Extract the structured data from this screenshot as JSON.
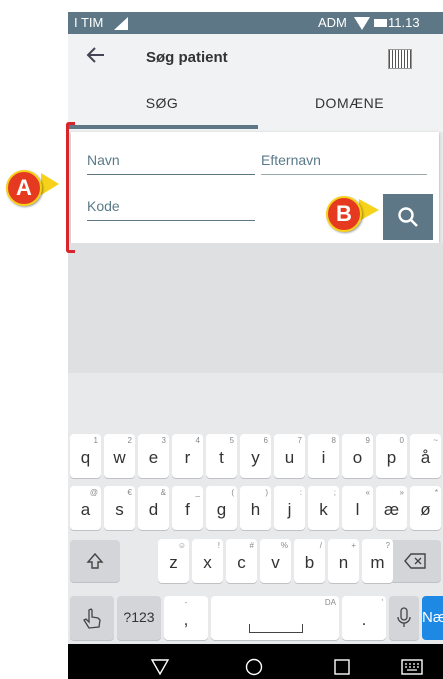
{
  "status_bar": {
    "carrier": "I TIM",
    "network": "ADM",
    "time": "11.13"
  },
  "app_bar": {
    "back_icon": "arrow-left-icon",
    "title": "Søg patient",
    "barcode_icon": "barcode-scanner-icon"
  },
  "tabs": [
    {
      "label": "SØG",
      "selected": true
    },
    {
      "label": "DOMÆNE",
      "selected": false
    }
  ],
  "form": {
    "navn_placeholder": "Navn",
    "efternavn_placeholder": "Efternavn",
    "kode_placeholder": "Kode",
    "search_icon": "search-icon"
  },
  "annotations": {
    "a": "A",
    "b": "B"
  },
  "keyboard": {
    "row1": [
      {
        "k": "q",
        "s": "1"
      },
      {
        "k": "w",
        "s": "2"
      },
      {
        "k": "e",
        "s": "3"
      },
      {
        "k": "r",
        "s": "4"
      },
      {
        "k": "t",
        "s": "5"
      },
      {
        "k": "y",
        "s": "6"
      },
      {
        "k": "u",
        "s": "7"
      },
      {
        "k": "i",
        "s": "8"
      },
      {
        "k": "o",
        "s": "9"
      },
      {
        "k": "p",
        "s": "0"
      },
      {
        "k": "å",
        "s": "~"
      }
    ],
    "row2": [
      {
        "k": "a",
        "s": "@"
      },
      {
        "k": "s",
        "s": "€"
      },
      {
        "k": "d",
        "s": "&"
      },
      {
        "k": "f",
        "s": "_"
      },
      {
        "k": "g",
        "s": "("
      },
      {
        "k": "h",
        "s": ")"
      },
      {
        "k": "j",
        "s": ":"
      },
      {
        "k": "k",
        "s": ";"
      },
      {
        "k": "l",
        "s": "«"
      },
      {
        "k": "æ",
        "s": "»"
      },
      {
        "k": "ø",
        "s": "*"
      }
    ],
    "row3": [
      {
        "k": "z",
        "s": "☺"
      },
      {
        "k": "x",
        "s": "!"
      },
      {
        "k": "c",
        "s": "#"
      },
      {
        "k": "v",
        "s": "%"
      },
      {
        "k": "b",
        "s": "/"
      },
      {
        "k": "n",
        "s": "+"
      },
      {
        "k": "m",
        "s": "?"
      }
    ],
    "numbers_label": "?123",
    "comma": ",",
    "comma_sub": "-",
    "language": "DA",
    "period": ".",
    "period_sub": "'",
    "action_label": "Næste",
    "action_color": "#1e88e5"
  },
  "accent_color": "#5d7786"
}
